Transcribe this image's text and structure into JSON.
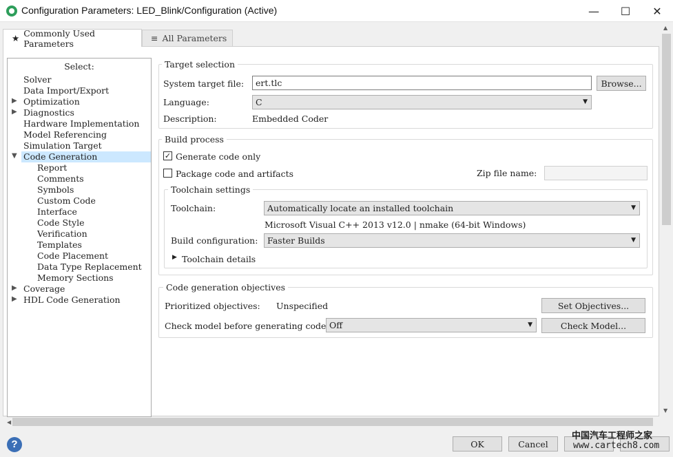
{
  "window": {
    "title": "Configuration Parameters: LED_Blink/Configuration (Active)",
    "controls": {
      "minimize": "—",
      "maximize": "☐",
      "close": "✕"
    }
  },
  "tabs": [
    {
      "label": "Commonly Used Parameters",
      "icon": "★",
      "active": true
    },
    {
      "label": "All Parameters",
      "icon": "≡",
      "active": false
    }
  ],
  "tree": {
    "header": "Select:",
    "items": [
      {
        "label": "Solver",
        "level": 0,
        "expander": ""
      },
      {
        "label": "Data Import/Export",
        "level": 0,
        "expander": ""
      },
      {
        "label": "Optimization",
        "level": 0,
        "expander": ">"
      },
      {
        "label": "Diagnostics",
        "level": 0,
        "expander": ">"
      },
      {
        "label": "Hardware Implementation",
        "level": 0,
        "expander": ""
      },
      {
        "label": "Model Referencing",
        "level": 0,
        "expander": ""
      },
      {
        "label": "Simulation Target",
        "level": 0,
        "expander": ""
      },
      {
        "label": "Code Generation",
        "level": 0,
        "expander": "v",
        "selected": true
      },
      {
        "label": "Report",
        "level": 1,
        "expander": ""
      },
      {
        "label": "Comments",
        "level": 1,
        "expander": ""
      },
      {
        "label": "Symbols",
        "level": 1,
        "expander": ""
      },
      {
        "label": "Custom Code",
        "level": 1,
        "expander": ""
      },
      {
        "label": "Interface",
        "level": 1,
        "expander": ""
      },
      {
        "label": "Code Style",
        "level": 1,
        "expander": ""
      },
      {
        "label": "Verification",
        "level": 1,
        "expander": ""
      },
      {
        "label": "Templates",
        "level": 1,
        "expander": ""
      },
      {
        "label": "Code Placement",
        "level": 1,
        "expander": ""
      },
      {
        "label": "Data Type Replacement",
        "level": 1,
        "expander": ""
      },
      {
        "label": "Memory Sections",
        "level": 1,
        "expander": ""
      },
      {
        "label": "Coverage",
        "level": 0,
        "expander": ">"
      },
      {
        "label": "HDL Code Generation",
        "level": 0,
        "expander": ">"
      }
    ]
  },
  "target_selection": {
    "title": "Target selection",
    "system_target_label": "System target file:",
    "system_target_value": "ert.tlc",
    "browse_label": "Browse...",
    "language_label": "Language:",
    "language_value": "C",
    "description_label": "Description:",
    "description_value": "Embedded Coder"
  },
  "build_process": {
    "title": "Build process",
    "generate_code_only_label": "Generate code only",
    "generate_code_only_checked": true,
    "package_code_label": "Package code and artifacts",
    "package_code_checked": false,
    "zip_label": "Zip file name:",
    "toolchain_settings": {
      "title": "Toolchain settings",
      "toolchain_label": "Toolchain:",
      "toolchain_value": "Automatically locate an installed toolchain",
      "toolchain_info": "Microsoft Visual C++ 2013 v12.0 | nmake (64-bit Windows)",
      "build_config_label": "Build configuration:",
      "build_config_value": "Faster Builds",
      "details_label": "Toolchain details"
    }
  },
  "objectives": {
    "title": "Code generation objectives",
    "prioritized_label": "Prioritized objectives:",
    "prioritized_value": "Unspecified",
    "set_objectives_label": "Set Objectives...",
    "check_model_label": "Check model before generating code:",
    "check_model_value": "Off",
    "check_model_button": "Check Model..."
  },
  "footer": {
    "ok": "OK",
    "cancel": "Cancel",
    "help_icon": "?"
  },
  "watermark": {
    "line1": "中国汽车工程师之家",
    "line2": "www.cartech8.com"
  },
  "colors": {
    "selection": "#cce8ff",
    "help_icon": "#3b6fb6",
    "app_icon": "#2e9e5b"
  }
}
